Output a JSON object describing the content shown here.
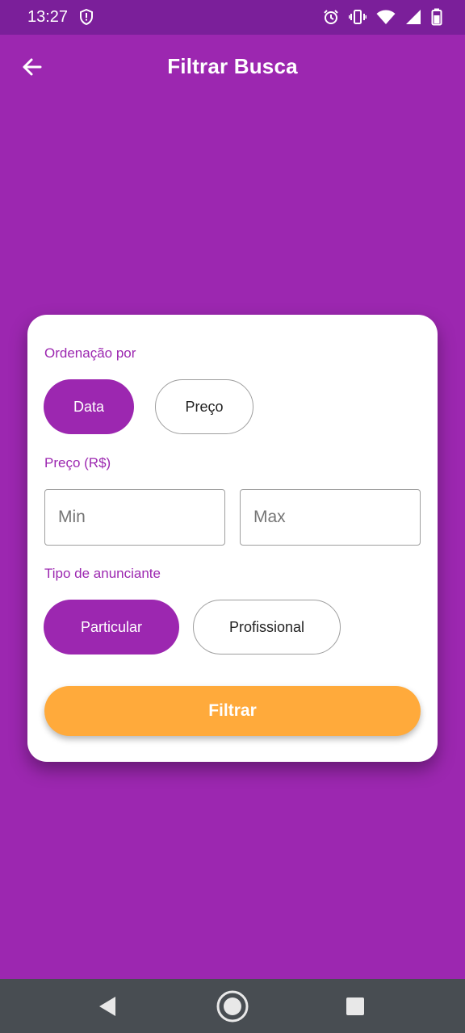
{
  "status_bar": {
    "time": "13:27",
    "icons": [
      "shield-icon",
      "alarm-icon",
      "vibrate-icon",
      "wifi-icon",
      "signal-icon",
      "battery-icon"
    ]
  },
  "app_bar": {
    "title": "Filtrar Busca",
    "back_icon": "arrow-back-icon"
  },
  "filter_card": {
    "sort_section": {
      "label": "Ordenação por",
      "options": [
        {
          "label": "Data",
          "selected": true
        },
        {
          "label": "Preço",
          "selected": false
        }
      ]
    },
    "price_section": {
      "label": "Preço (R$)",
      "min_placeholder": "Min",
      "max_placeholder": "Max",
      "min_value": "",
      "max_value": ""
    },
    "advertiser_section": {
      "label": "Tipo de anunciante",
      "options": [
        {
          "label": "Particular",
          "selected": true
        },
        {
          "label": "Profissional",
          "selected": false
        }
      ]
    },
    "submit_label": "Filtrar"
  },
  "nav_bar": {
    "buttons": [
      "back-triangle-icon",
      "home-circle-icon",
      "recents-square-icon"
    ]
  },
  "colors": {
    "primary": "#9c27b0",
    "status_bar": "#7b1f9a",
    "accent": "#ffaa3b",
    "nav_bar": "#484d52"
  }
}
